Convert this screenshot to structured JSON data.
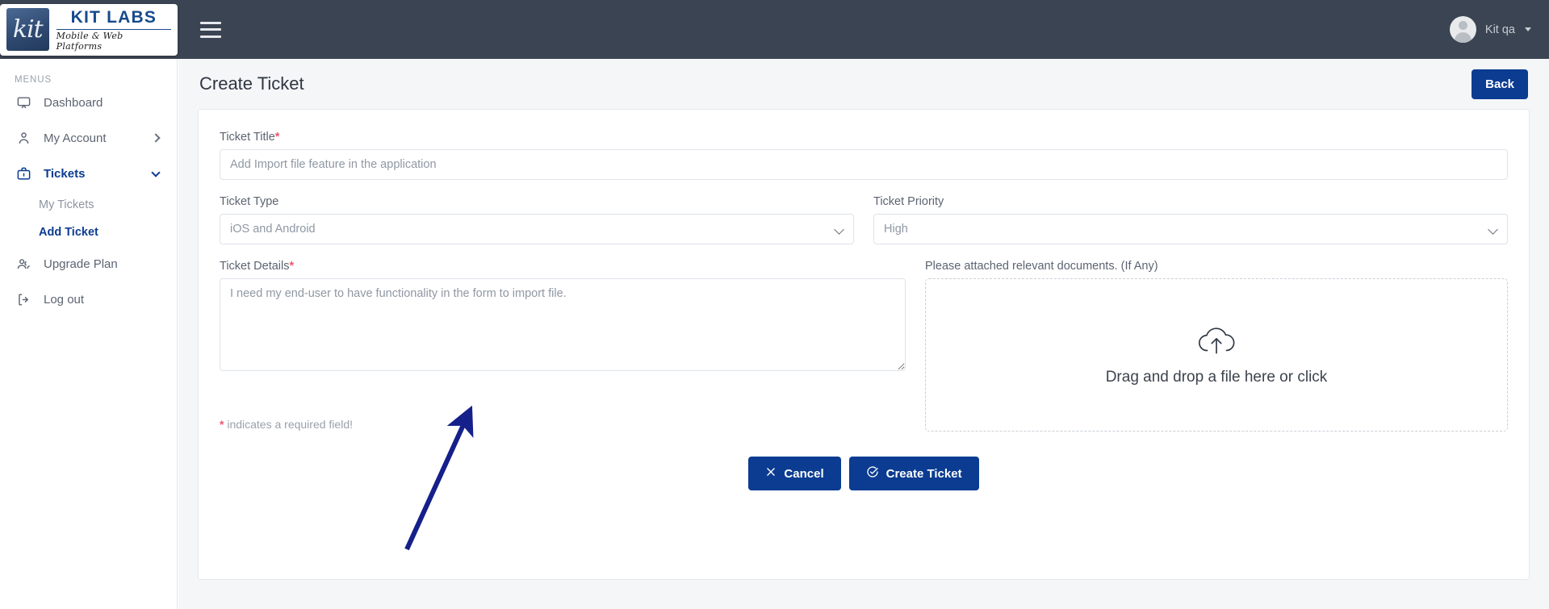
{
  "topbar": {
    "logo": {
      "mark_text": "kit",
      "title": "KIT LABS",
      "subtitle": "Mobile & Web Platforms"
    },
    "menu_toggle_name": "hamburger-menu-icon",
    "user": {
      "name": "Kit qa",
      "avatar_icon": "user-avatar-icon",
      "caret_icon": "chevron-down-icon"
    },
    "background_color": "#3b4452"
  },
  "sidebar": {
    "section_label": "MENUS",
    "items": [
      {
        "label": "Dashboard",
        "icon": "dashboard-icon",
        "active": false,
        "has_chevron": false
      },
      {
        "label": "My Account",
        "icon": "user-icon",
        "active": false,
        "has_chevron": true
      },
      {
        "label": "Tickets",
        "icon": "briefcase-icon",
        "active": true,
        "has_chevron": true
      },
      {
        "label": "Upgrade Plan",
        "icon": "users-icon",
        "active": false,
        "has_chevron": false
      },
      {
        "label": "Log out",
        "icon": "logout-icon",
        "active": false,
        "has_chevron": false
      }
    ],
    "sub_items": [
      {
        "label": "My Tickets",
        "active": false
      },
      {
        "label": "Add Ticket",
        "active": true
      }
    ]
  },
  "page": {
    "title": "Create Ticket",
    "back_button": "Back",
    "accent_color": "#0b3c91"
  },
  "form": {
    "ticket_title": {
      "label": "Ticket Title",
      "required": true,
      "value": "",
      "placeholder": "Add Import file feature in the application"
    },
    "ticket_type": {
      "label": "Ticket Type",
      "required": false,
      "value": "iOS and Android",
      "options": [
        "iOS and Android"
      ]
    },
    "ticket_priority": {
      "label": "Ticket Priority",
      "required": false,
      "value": "High",
      "options": [
        "High"
      ]
    },
    "ticket_details": {
      "label": "Ticket Details",
      "required": true,
      "value": "",
      "placeholder": "I need my end-user to have functionality in the form to import file."
    },
    "attachments": {
      "label": "Please attached relevant documents. (If Any)",
      "dropzone_text": "Drag and drop a file here or click",
      "dropzone_icon": "cloud-upload-icon"
    },
    "required_note_marker": "*",
    "required_note": " indicates a required field!",
    "required_color": "#f0556d"
  },
  "actions": {
    "cancel": {
      "label": "Cancel",
      "icon": "close-x-icon"
    },
    "submit": {
      "label": "Create Ticket",
      "icon": "check-circle-icon"
    }
  },
  "annotation": {
    "type": "arrow",
    "color": "#15208a"
  }
}
